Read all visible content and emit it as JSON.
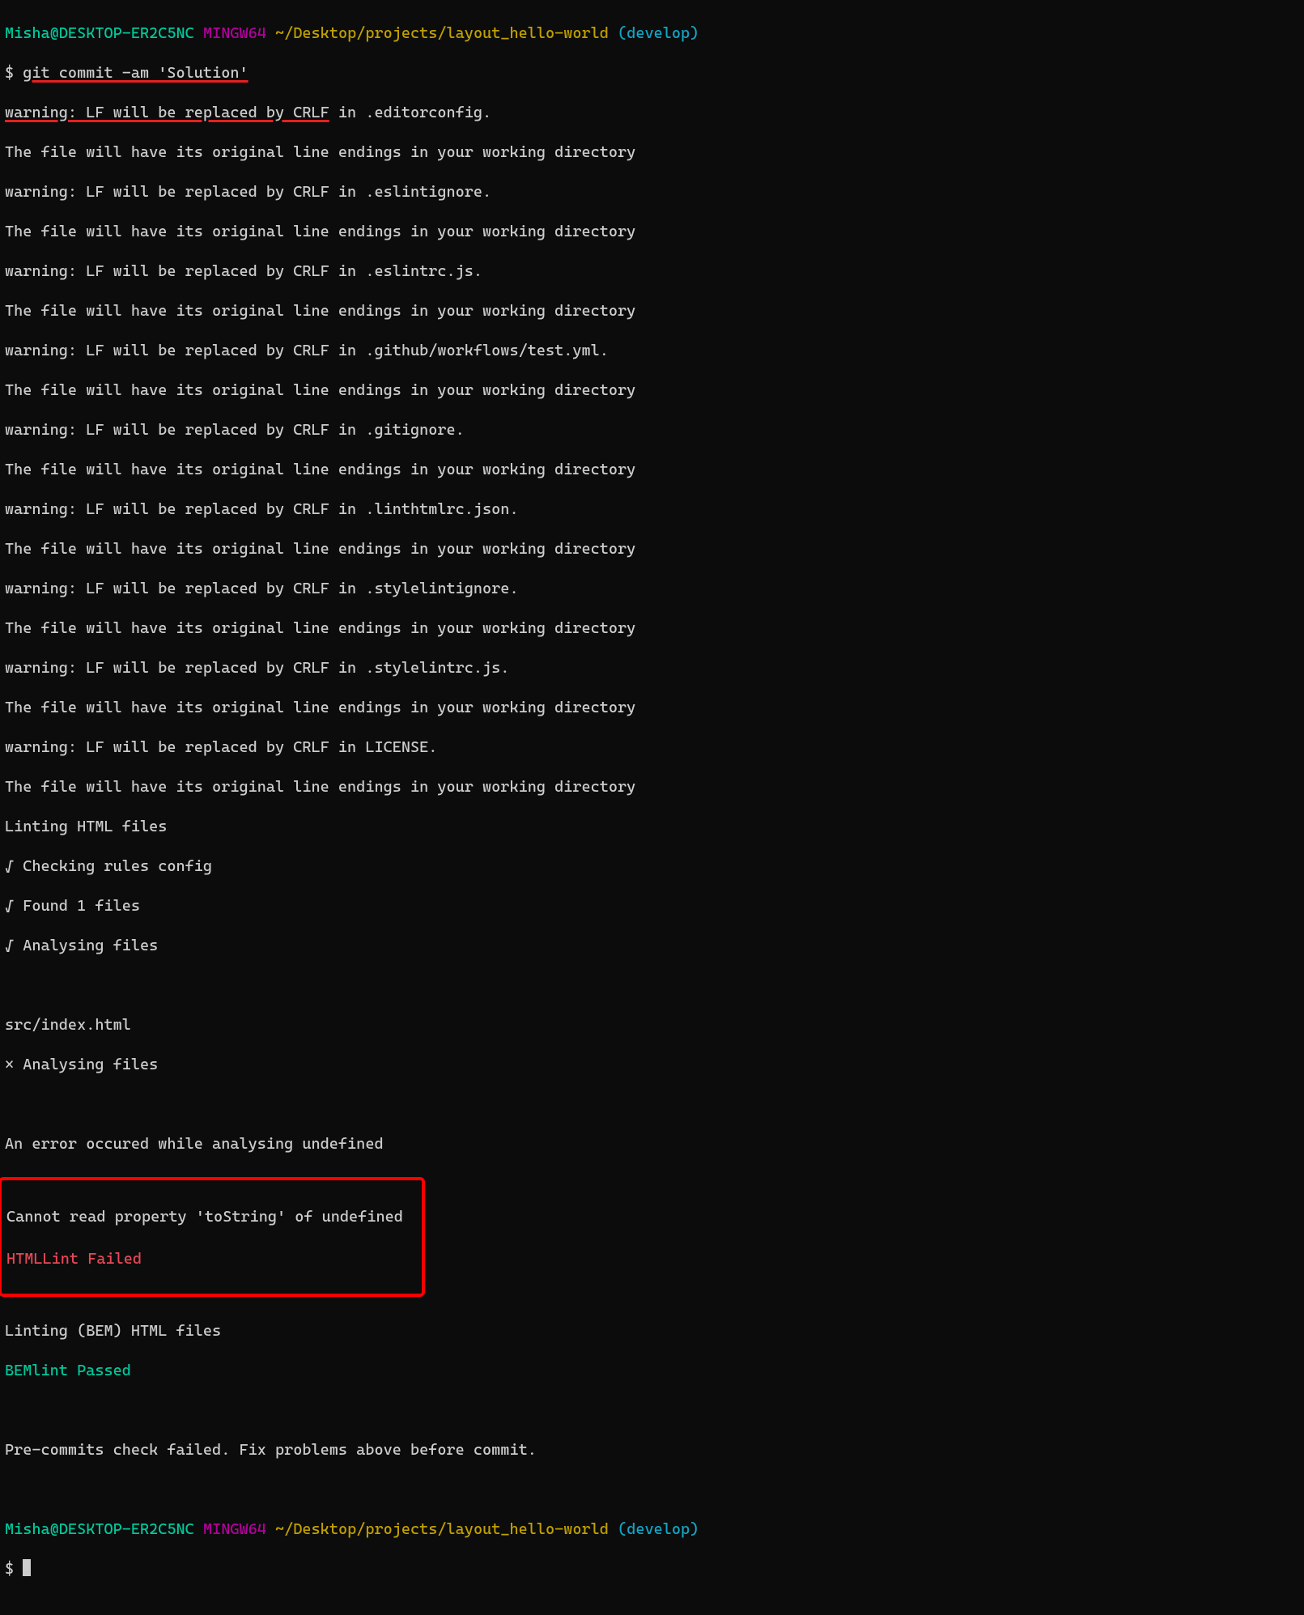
{
  "prompt1": {
    "user": "Misha@DESKTOP-ER2C5NC",
    "env": "MINGW64",
    "path": "~/Desktop/projects/layout_hello-world",
    "branch": "(develop)"
  },
  "command1": {
    "symbol": "$ ",
    "text": "git commit -am 'Solution'"
  },
  "warn1": {
    "underlined": "warning: LF will be replaced by CRLF",
    "rest": " in .editorconfig."
  },
  "lines": {
    "l02": "The file will have its original line endings in your working directory",
    "l03": "warning: LF will be replaced by CRLF in .eslintignore.",
    "l04": "The file will have its original line endings in your working directory",
    "l05": "warning: LF will be replaced by CRLF in .eslintrc.js.",
    "l06": "The file will have its original line endings in your working directory",
    "l07": "warning: LF will be replaced by CRLF in .github/workflows/test.yml.",
    "l08": "The file will have its original line endings in your working directory",
    "l09": "warning: LF will be replaced by CRLF in .gitignore.",
    "l10": "The file will have its original line endings in your working directory",
    "l11": "warning: LF will be replaced by CRLF in .linthtmlrc.json.",
    "l12": "The file will have its original line endings in your working directory",
    "l13": "warning: LF will be replaced by CRLF in .stylelintignore.",
    "l14": "The file will have its original line endings in your working directory",
    "l15": "warning: LF will be replaced by CRLF in .stylelintrc.js.",
    "l16": "The file will have its original line endings in your working directory",
    "l17": "warning: LF will be replaced by CRLF in LICENSE.",
    "l18": "The file will have its original line endings in your working directory",
    "l19": "Linting HTML files",
    "l20": "√ Checking rules config",
    "l21": "√ Found 1 files",
    "l22": "√ Analysing files",
    "l23": "",
    "l24": "src/index.html",
    "l25": "× Analysing files",
    "l26": "",
    "l27": "An error occured while analysing undefined"
  },
  "errorBox": {
    "l1": "Cannot read property 'toString' of undefined",
    "l2": "HTMLLint Failed"
  },
  "after": {
    "a1": "Linting (BEM) HTML files",
    "a2": "BEMlint Passed",
    "a3": "",
    "a4": "Pre-commits check failed. Fix problems above before commit.",
    "a5": ""
  },
  "prompt2": {
    "user": "Misha@DESKTOP-ER2C5NC",
    "env": "MINGW64",
    "path": "~/Desktop/projects/layout_hello-world",
    "branch": "(develop)"
  },
  "command2": {
    "symbol": "$ "
  }
}
